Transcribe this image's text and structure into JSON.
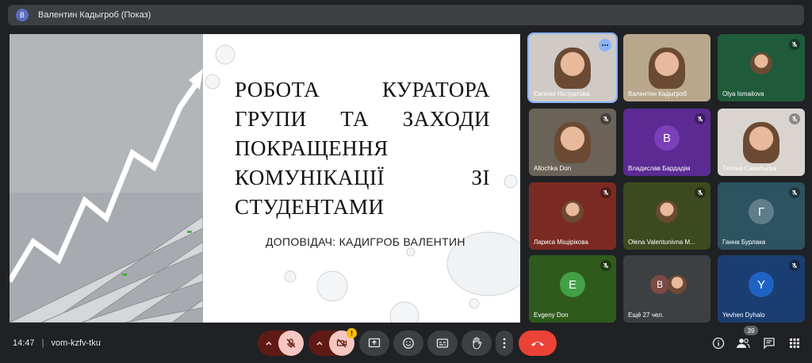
{
  "presenter": {
    "avatar_letter": "В",
    "title": "Валентин Кадыгроб (Показ)"
  },
  "slide": {
    "title_lines": [
      "РОБОТА КУРАТОРА",
      "ГРУПИ ТА ЗАХОДИ",
      "ПОКРАЩЕННЯ",
      "КОМУНІКАЦІЇ ЗІ",
      "СТУДЕНТАМИ"
    ],
    "speaker": "ДОПОВІДАЧ: КАДИГРОБ ВАЛЕНТИН"
  },
  "participants": [
    {
      "name": "Євгенія Ністратова",
      "type": "video",
      "bg": "#cfcac6",
      "mic": "more"
    },
    {
      "name": "Валентин Кадыгроб",
      "type": "video",
      "bg": "#b8a78c",
      "mic": "none"
    },
    {
      "name": "Olya Ismailova",
      "type": "photo",
      "bg": "#1f5a3b",
      "mic": "muted"
    },
    {
      "name": "Allochka Don",
      "type": "video",
      "bg": "#6b6258",
      "mic": "muted"
    },
    {
      "name": "Владислав Бардадім",
      "type": "letter",
      "letter": "В",
      "bg": "#5b2a93",
      "circle": "#7b3fb8",
      "mic": "muted"
    },
    {
      "name": "Тетяна Савельєва",
      "type": "video",
      "bg": "#d9d4cf",
      "mic": "muted"
    },
    {
      "name": "Лариса Міщірікова",
      "type": "photo",
      "bg": "#7a2a22",
      "mic": "muted"
    },
    {
      "name": "Olena Valentunivna M...",
      "type": "photo",
      "bg": "#3d4a1f",
      "mic": "muted"
    },
    {
      "name": "Ганна Бурлака",
      "type": "letter",
      "letter": "Г",
      "bg": "#2d5260",
      "circle": "#607d8b",
      "mic": "muted"
    },
    {
      "name": "Evgeny Don",
      "type": "letter",
      "letter": "E",
      "bg": "#2f5a1c",
      "circle": "#43a047",
      "mic": "muted"
    },
    {
      "name": "Ещё 27 чел.",
      "type": "more",
      "letter": "В",
      "bg": "#3c4043",
      "mic": "none"
    },
    {
      "name": "Yevhen Dyhalo",
      "type": "letter",
      "letter": "Y",
      "bg": "#1b3e72",
      "circle": "#1e63c4",
      "mic": "muted"
    }
  ],
  "bottom": {
    "time": "14:47",
    "separator": "|",
    "meeting_code": "vom-kzfv-tku",
    "participant_count": "39"
  },
  "colors": {
    "end_call": "#ea4335",
    "muted_ctl": "#f6c7c2",
    "toggle_dark": "#5f1a15",
    "ctl_bg": "#3c4043"
  },
  "icons": [
    "mic-off-icon",
    "camera-off-icon",
    "present-icon",
    "emoji-icon",
    "captions-icon",
    "raise-hand-icon",
    "more-icon",
    "end-call-icon",
    "info-icon",
    "people-icon",
    "chat-icon",
    "activities-icon"
  ]
}
